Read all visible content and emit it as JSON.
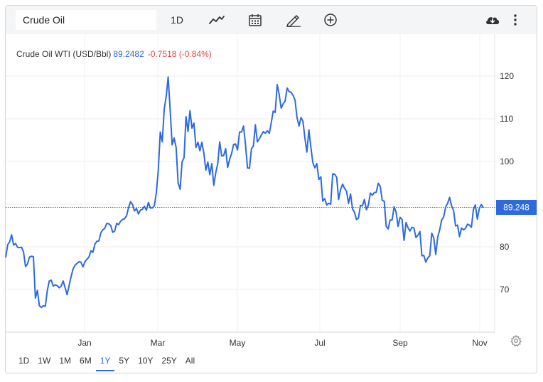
{
  "toolbar": {
    "search_value": "Crude Oil",
    "interval_label": "1D"
  },
  "legend": {
    "name": "Crude Oil WTI (USD/Bbl)",
    "price": "89.2482",
    "change": "-0.7518 (-0.84%)"
  },
  "last_price_label": "89.248",
  "ranges": [
    "1D",
    "1W",
    "1M",
    "6M",
    "1Y",
    "5Y",
    "10Y",
    "25Y",
    "All"
  ],
  "active_range": "1Y",
  "colors": {
    "line": "#2d6ae0",
    "negative": "#e0454a",
    "toolbar_bg": "#f4f5f6"
  },
  "icons": [
    "line-chart-icon",
    "calendar-icon",
    "pencil-icon",
    "plus-circle-icon",
    "cloud-download-icon",
    "more-vertical-icon",
    "gear-icon"
  ],
  "chart_data": {
    "type": "line",
    "series": [
      {
        "values": [
          77.5,
          80.5,
          81.2,
          82.8,
          80.4,
          80.8,
          79.9,
          79.8,
          79.9,
          78.8,
          75.4,
          76.0,
          77.6,
          77.8,
          77.7,
          68.0,
          69.8,
          66.2,
          65.8,
          66.2,
          66.1,
          69.8,
          72.0,
          72.2,
          70.8,
          71.1,
          70.9,
          70.4,
          70.8,
          72.0,
          70.4,
          68.8,
          70.9,
          73.0,
          74.8,
          75.7,
          76.1,
          76.5,
          76.4,
          75.3,
          76.5,
          77.1,
          77.6,
          79.1,
          78.7,
          80.6,
          81.3,
          81.4,
          83.2,
          84.0,
          84.3,
          85.5,
          85.4,
          85.0,
          83.4,
          83.7,
          85.5,
          85.2,
          86.0,
          86.4,
          86.6,
          87.3,
          89.2,
          90.6,
          89.9,
          88.4,
          89.0,
          87.7,
          88.6,
          88.8,
          89.5,
          88.6,
          90.4,
          89.1,
          89.1,
          89.6,
          92.6,
          97.9,
          106.9,
          104.6,
          112.3,
          115.3,
          119.8,
          112.1,
          103.9,
          105.5,
          103.3,
          95.0,
          93.5,
          99.9,
          100.9,
          110.5,
          107.0,
          111.9,
          107.8,
          109.0,
          103.3,
          104.5,
          102.5,
          104.5,
          102.0,
          98.0,
          99.9,
          96.9,
          99.5,
          94.4,
          97.4,
          99.5,
          104.6,
          101.3,
          101.4,
          103.0,
          98.6,
          100.5,
          101.9,
          104.0,
          104.1,
          102.7,
          106.9,
          106.9,
          108.3,
          104.0,
          98.5,
          98.4,
          103.0,
          103.6,
          108.6,
          104.6,
          105.3,
          106.2,
          107.0,
          106.6,
          107.2,
          106.6,
          109.0,
          111.8,
          111.5,
          118.0,
          115.7,
          112.5,
          113.5,
          114.2,
          117.2,
          116.4,
          116.2,
          115.5,
          114.4,
          110.3,
          108.3,
          110.3,
          109.4,
          105.5,
          102.2,
          107.4,
          103.3,
          99.7,
          98.5,
          99.5,
          95.8,
          96.4,
          90.7,
          91.3,
          89.8,
          90.2,
          90.0,
          97.1,
          97.0,
          96.3,
          91.1,
          93.4,
          94.7,
          93.7,
          93.0,
          90.2,
          92.4,
          88.9,
          88.1,
          86.4,
          86.7,
          89.7,
          89.6,
          91.1,
          88.7,
          89.8,
          92.6,
          92.1,
          92.7,
          92.8,
          94.9,
          94.2,
          90.9,
          90.7,
          84.8,
          84.2,
          86.3,
          86.3,
          89.4,
          88.1,
          84.8,
          86.9,
          86.4,
          81.5,
          85.7,
          84.5,
          83.7,
          84.6,
          84.4,
          82.2,
          82.7,
          83.6,
          77.9,
          78.0,
          76.4,
          77.4,
          77.9,
          83.2,
          82.1,
          78.2,
          82.3,
          84.0,
          86.3,
          87.0,
          89.3,
          90.2,
          91.6,
          89.6,
          88.5,
          84.9,
          85.1,
          82.4,
          84.4,
          84.0,
          84.3,
          85.3,
          85.1,
          84.6,
          88.8,
          89.8,
          86.5,
          89.0,
          89.9,
          89.2
        ]
      }
    ],
    "x_ticks": [
      "Jan",
      "Mar",
      "May",
      "Jul",
      "Sep",
      "Nov"
    ],
    "y_ticks": [
      70,
      80,
      90,
      100,
      110,
      120
    ],
    "ylim": [
      60,
      120
    ],
    "last_value": 89.2482,
    "grid": true
  }
}
